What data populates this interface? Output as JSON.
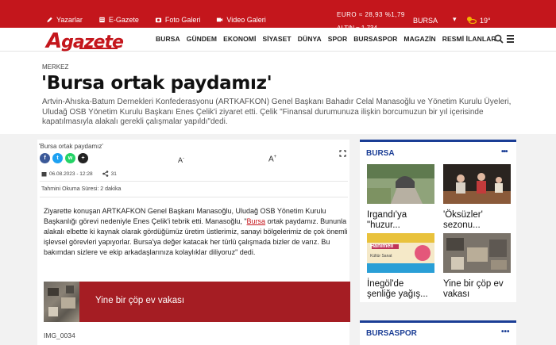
{
  "topbar": {
    "links": [
      {
        "label": "Yazarlar",
        "icon": "pen-icon"
      },
      {
        "label": "E-Gazete",
        "icon": "newspaper-icon"
      },
      {
        "label": "Foto Galeri",
        "icon": "camera-icon"
      },
      {
        "label": "Video Galeri",
        "icon": "video-icon"
      }
    ],
    "ticker_top": "EURO ≈ 28,93 %1,79",
    "ticker_bottom": "ALTIN ≈ 1.734",
    "city": "BURSA",
    "temperature": "19°"
  },
  "nav": {
    "logo": "gazete",
    "logo_first": "A",
    "menu": [
      "BURSA",
      "GÜNDEM",
      "EKONOMİ",
      "SİYASET",
      "DÜNYA",
      "SPOR",
      "BURSASPOR",
      "MAGAZİN",
      "RESMİ İLANLAR"
    ]
  },
  "article": {
    "category": "MERKEZ",
    "title": "'Bursa ortak paydamız'",
    "lead": "Artvin-Ahıska-Batum Dernekleri Konfederasyonu (ARTKAFKON) Genel Başkanı Bahadır Celal Manasoğlu ve Yönetim Kurulu Üyeleri, Uludağ OSB Yönetim Kurulu Başkanı Enes Çelik'i ziyaret etti. Çelik \"Finansal durumunuza ilişkin borcumuzun bir yıl içerisinde kapatılmasıyla alakalı gerekli çalışmalar yapıldı\"dedi.",
    "card_title": "'Bursa ortak paydamız'",
    "share": {
      "facebook": "f",
      "twitter": "t",
      "whatsapp": "w",
      "more": "+"
    },
    "font_small": "A",
    "font_big": "A",
    "font_sup_minus": "-",
    "font_sup_plus": "+",
    "date": "06.08.2023 - 12:28",
    "share_count": "31",
    "read_time": "Tahmini Okuma Süresi: 2 dakika",
    "body_before": "Ziyarette konuşan ARTKAFKON Genel Başkanı Manasoğlu, Uludağ OSB Yönetim Kurulu Başkanlığı görevi nedeniyle Enes Çelik'i tebrik etti. Manasoğlu, \"",
    "body_link": "Bursa",
    "body_after": " ortak paydamız. Bununla alakalı elbette ki kaynak olarak gördüğümüz üretim üstlerimiz, sanayi bölgelerimiz de çok önemli işlevsel görevleri yapıyorlar. Bursa'ya değer katacak her türlü çalışmada bizler de varız. Bu bakımdan sizlere ve ekip arkadaşlarınıza kolaylıklar diliyoruz\" dedi.",
    "related_title": "Yine bir çöp ev vakası",
    "image_caption": "IMG_0034"
  },
  "sidebar": {
    "heading": "BURSA",
    "more": "•••",
    "tiles": [
      {
        "title": "Irgandı'ya \"huzur..."
      },
      {
        "title": "'Öksüzler' sezonu..."
      },
      {
        "title": "İnegöl'de şenliğe yağış..."
      },
      {
        "title": "Yine bir çöp ev vakası"
      }
    ],
    "banner_text": "Hanımeli",
    "banner_sub": "Kültür Sanat",
    "heading2": "BURSASPOR",
    "more2": "•••"
  },
  "colors": {
    "brand_red": "#c4161c",
    "accent_blue": "#1a3d95",
    "related_red": "#a51d23"
  }
}
